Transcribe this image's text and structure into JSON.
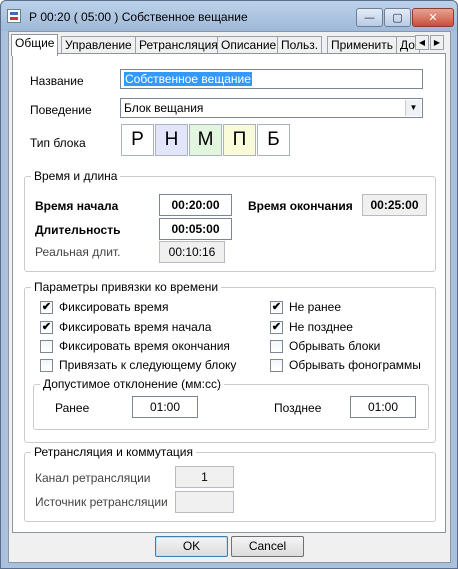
{
  "window": {
    "title": "Р 00:20 ( 05:00 ) Собственное вещание",
    "controls": {
      "minimize": "—",
      "maximize": "▢",
      "close": "✕"
    }
  },
  "tabs": [
    {
      "label": "Общие",
      "active": true
    },
    {
      "label": "Управление",
      "active": false
    },
    {
      "label": "Ретрансляция",
      "active": false
    },
    {
      "label": "Описание",
      "active": false
    },
    {
      "label": "Польз.",
      "active": false
    },
    {
      "label": "Применить",
      "active": false
    },
    {
      "label": "До",
      "active": false
    }
  ],
  "tab_scroll": {
    "left": "◀",
    "right": "▶"
  },
  "general": {
    "name_label": "Название",
    "name_value": "Собственное вещание",
    "behavior_label": "Поведение",
    "behavior_value": "Блок вещания",
    "block_type_label": "Тип блока",
    "block_types": [
      {
        "letter": "Р",
        "color": "#ffffff"
      },
      {
        "letter": "Н",
        "color": "#e3e6fb"
      },
      {
        "letter": "М",
        "color": "#e2f6df"
      },
      {
        "letter": "П",
        "color": "#fafbd8"
      },
      {
        "letter": "Б",
        "color": "#ffffff"
      }
    ]
  },
  "time": {
    "legend": "Время и длина",
    "start_label": "Время начала",
    "start_value": "00:20:00",
    "end_label": "Время окончания",
    "end_value": "00:25:00",
    "duration_label": "Длительность",
    "duration_value": "00:05:00",
    "real_duration_label": "Реальная длит.",
    "real_duration_value": "00:10:16"
  },
  "binding": {
    "legend": "Параметры привязки ко времени",
    "left_checks": [
      {
        "label": "Фиксировать время",
        "checked": true
      },
      {
        "label": "Фиксировать время начала",
        "checked": true
      },
      {
        "label": "Фиксировать время окончания",
        "checked": false
      },
      {
        "label": "Привязать к следующему блоку",
        "checked": false
      }
    ],
    "right_checks": [
      {
        "label": "Не ранее",
        "checked": true
      },
      {
        "label": "Не позднее",
        "checked": true
      },
      {
        "label": "Обрывать блоки",
        "checked": false
      },
      {
        "label": "Обрывать фонограммы",
        "checked": false
      }
    ],
    "deviation": {
      "legend": "Допустимое отклонение (мм:сс)",
      "earlier_label": "Ранее",
      "earlier_value": "01:00",
      "later_label": "Позднее",
      "later_value": "01:00"
    }
  },
  "relay": {
    "legend": "Ретрансляция и коммутация",
    "channel_label": "Канал ретрансляции",
    "channel_value": "1",
    "source_label": "Источник ретрансляции",
    "source_value": ""
  },
  "buttons": {
    "ok": "OK",
    "cancel": "Cancel"
  },
  "check_glyph": "✔"
}
